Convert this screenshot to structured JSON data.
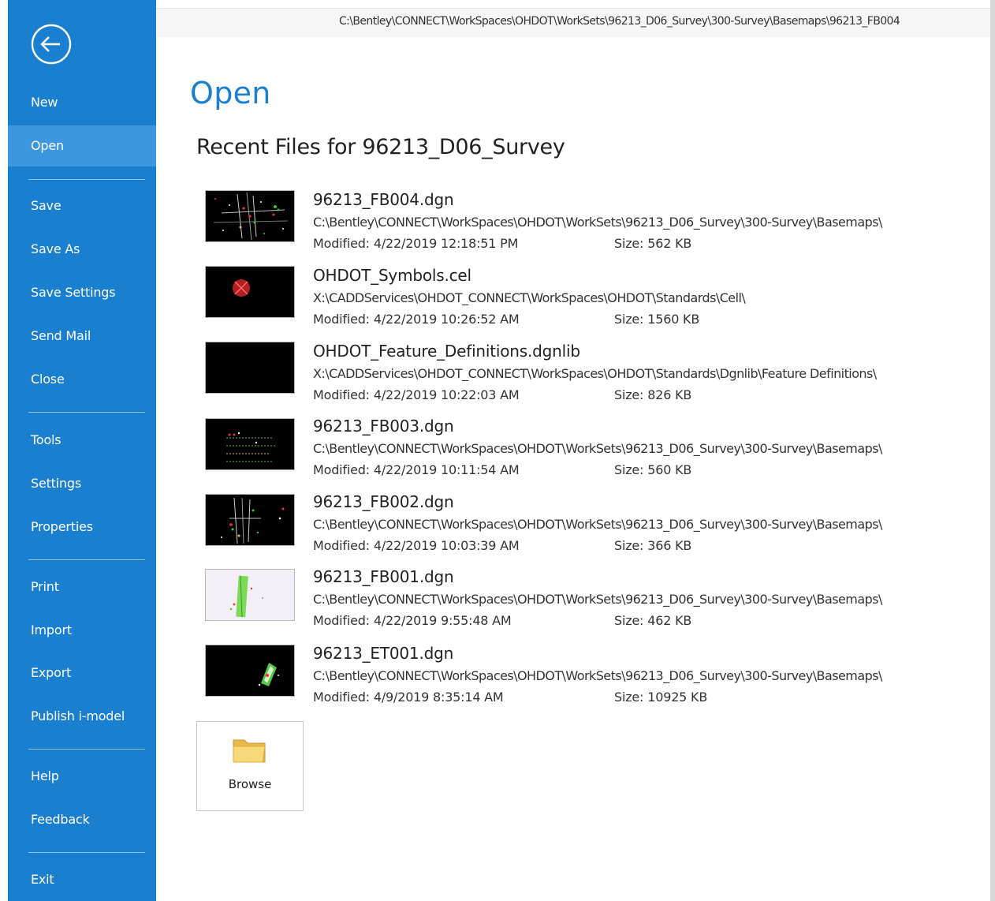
{
  "window": {
    "path": "C:\\Bentley\\CONNECT\\WorkSpaces\\OHDOT\\WorkSets\\96213_D06_Survey\\300-Survey\\Basemaps\\96213_FB004"
  },
  "sidebar": {
    "back_icon": "back-arrow-circle-icon",
    "items": [
      {
        "label": "New"
      },
      {
        "label": "Open",
        "active": true
      },
      {
        "label": "Save"
      },
      {
        "label": "Save As"
      },
      {
        "label": "Save Settings"
      },
      {
        "label": "Send Mail"
      },
      {
        "label": "Close"
      },
      {
        "label": "Tools"
      },
      {
        "label": "Settings"
      },
      {
        "label": "Properties"
      },
      {
        "label": "Print"
      },
      {
        "label": "Import"
      },
      {
        "label": "Export"
      },
      {
        "label": "Publish i-model"
      },
      {
        "label": "Help"
      },
      {
        "label": "Feedback"
      },
      {
        "label": "Exit"
      }
    ],
    "bg_color": "#1b7fd0",
    "active_color": "#3c97de"
  },
  "main": {
    "title": "Open",
    "recent_heading": "Recent Files for 96213_D06_Survey",
    "modified_label": "Modified:",
    "size_label": "Size:",
    "files": [
      {
        "name": "96213_FB004.dgn",
        "path": "C:\\Bentley\\CONNECT\\WorkSpaces\\OHDOT\\WorkSets\\96213_D06_Survey\\300-Survey\\Basemaps\\",
        "modified": "4/22/2019 12:18:51 PM",
        "size": "562 KB"
      },
      {
        "name": "OHDOT_Symbols.cel",
        "path": "X:\\CADDServices\\OHDOT_CONNECT\\WorkSpaces\\OHDOT\\Standards\\Cell\\",
        "modified": "4/22/2019 10:26:52 AM",
        "size": "1560 KB"
      },
      {
        "name": "OHDOT_Feature_Definitions.dgnlib",
        "path": "X:\\CADDServices\\OHDOT_CONNECT\\WorkSpaces\\OHDOT\\Standards\\Dgnlib\\Feature Definitions\\",
        "modified": "4/22/2019 10:22:03 AM",
        "size": "826 KB"
      },
      {
        "name": "96213_FB003.dgn",
        "path": "C:\\Bentley\\CONNECT\\WorkSpaces\\OHDOT\\WorkSets\\96213_D06_Survey\\300-Survey\\Basemaps\\",
        "modified": "4/22/2019 10:11:54 AM",
        "size": "560 KB"
      },
      {
        "name": "96213_FB002.dgn",
        "path": "C:\\Bentley\\CONNECT\\WorkSpaces\\OHDOT\\WorkSets\\96213_D06_Survey\\300-Survey\\Basemaps\\",
        "modified": "4/22/2019 10:03:39 AM",
        "size": "366 KB"
      },
      {
        "name": "96213_FB001.dgn",
        "path": "C:\\Bentley\\CONNECT\\WorkSpaces\\OHDOT\\WorkSets\\96213_D06_Survey\\300-Survey\\Basemaps\\",
        "modified": "4/22/2019 9:55:48 AM",
        "size": "462 KB"
      },
      {
        "name": "96213_ET001.dgn",
        "path": "C:\\Bentley\\CONNECT\\WorkSpaces\\OHDOT\\WorkSets\\96213_D06_Survey\\300-Survey\\Basemaps\\",
        "modified": "4/9/2019 8:35:14 AM",
        "size": "10925 KB"
      }
    ],
    "browse": {
      "label": "Browse",
      "icon": "folder-icon"
    }
  }
}
